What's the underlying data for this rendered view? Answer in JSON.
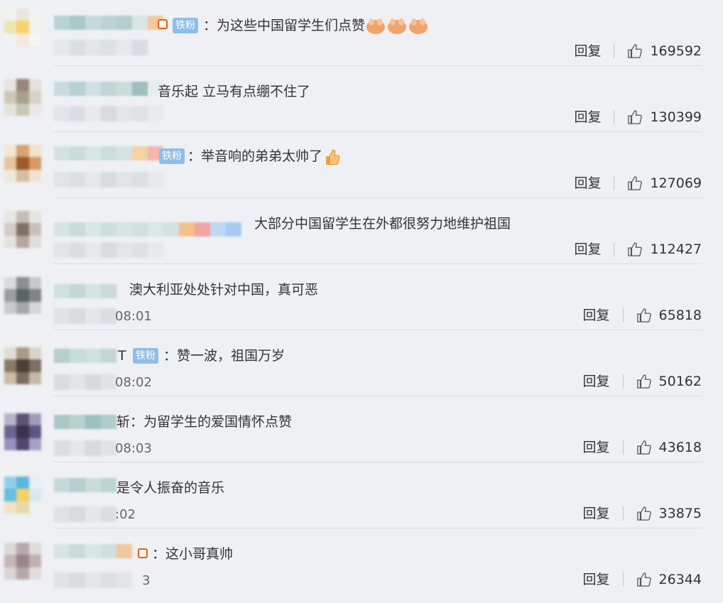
{
  "badge_label": "铁粉",
  "reply_label": "回复",
  "colors": {
    "badge": "#8fbde8",
    "text": "#333333",
    "divider": "#d9dbe0",
    "background": "#eef0f4"
  },
  "comments": [
    {
      "name_tail": "",
      "badge": true,
      "text": "：为这些中国留学生们点赞",
      "time": "",
      "likes": "169592",
      "emoji": "clap-hands-icon"
    },
    {
      "name_tail": "",
      "badge": false,
      "text": "音乐起 立马有点绷不住了",
      "time": "",
      "likes": "130399"
    },
    {
      "name_tail": "",
      "badge": true,
      "text": "：举音响的弟弟太帅了",
      "time": "",
      "likes": "127069",
      "emoji": "thumbs-up-icon"
    },
    {
      "name_tail": "",
      "badge": false,
      "text": "大部分中国留学生在外都很努力地维护祖国",
      "time": "",
      "likes": "112427"
    },
    {
      "name_tail": "",
      "badge": false,
      "text": "澳大利亚处处针对中国，真可恶",
      "time": "08:01",
      "likes": "65818"
    },
    {
      "name_tail": "T",
      "badge": true,
      "text": "：赞一波，祖国万岁",
      "time": "08:02",
      "likes": "50162"
    },
    {
      "name_tail": "",
      "badge": false,
      "text": "斩：为留学生的爱国情怀点赞",
      "time": "08:03",
      "likes": "43618"
    },
    {
      "name_tail": "",
      "badge": false,
      "text": "是令人振奋的音乐",
      "time": ":02",
      "likes": "33875"
    },
    {
      "name_tail": "",
      "badge": false,
      "text": "：这小哥真帅",
      "time": "3",
      "likes": "26344"
    }
  ]
}
